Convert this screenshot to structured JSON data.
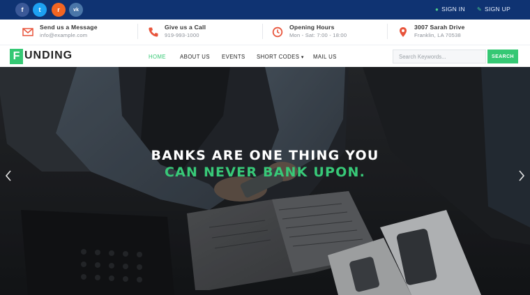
{
  "topbar": {
    "social": [
      {
        "name": "facebook",
        "glyph": "f",
        "color": "#3b5998"
      },
      {
        "name": "twitter",
        "glyph": "t",
        "color": "#1da1f2"
      },
      {
        "name": "rss",
        "glyph": "r",
        "color": "#f26522"
      },
      {
        "name": "vk",
        "glyph": "vk",
        "color": "#4a76a8"
      }
    ],
    "sign_in": "SIGN IN",
    "sign_up": "SIGN UP"
  },
  "info": [
    {
      "title": "Send us a Message",
      "sub": "info@example.com",
      "icon": "envelope-icon"
    },
    {
      "title": "Give us a Call",
      "sub": "919-993-1000",
      "icon": "phone-icon"
    },
    {
      "title": "Opening Hours",
      "sub": "Mon - Sat: 7:00 - 18:00",
      "icon": "clock-icon"
    },
    {
      "title": "3007 Sarah Drive",
      "sub": "Franklin, LA 70538",
      "icon": "map-pin-icon"
    }
  ],
  "logo": {
    "first": "F",
    "rest": "UNDING"
  },
  "nav": {
    "items": [
      "HOME",
      "ABOUT US",
      "EVENTS",
      "SHORT CODES",
      "MAIL US"
    ],
    "dropdown_caret": "▾",
    "search_placeholder": "Search Keywords...",
    "search_button": "SEARCH"
  },
  "hero": {
    "line1": "BANKS ARE ONE THING YOU",
    "line2": "CAN NEVER BANK UPON."
  },
  "colors": {
    "topbar": "#0f3372",
    "accent": "#35c874",
    "icon_accent": "#e8543b"
  }
}
